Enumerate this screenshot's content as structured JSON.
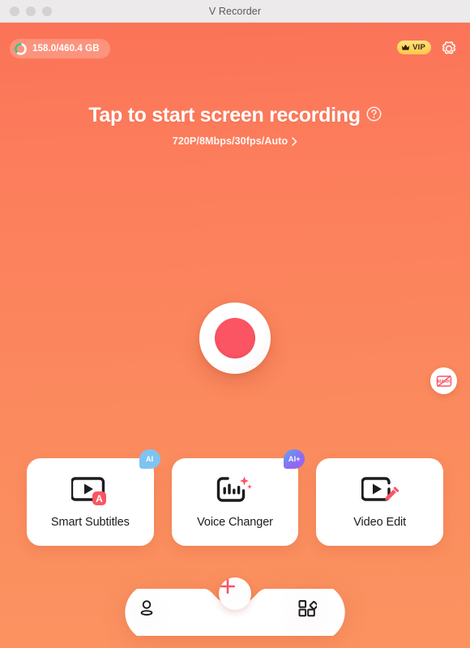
{
  "window": {
    "title": "V Recorder",
    "traffic_lights": [
      "close",
      "minimize",
      "zoom"
    ]
  },
  "topbar": {
    "storage_text": "158.0/460.4 GB",
    "storage_used_gb": 158.0,
    "storage_total_gb": 460.4,
    "vip_label": "VIP",
    "vip_icon": "crown-icon",
    "settings_icon": "gear-icon"
  },
  "hero": {
    "headline": "Tap to start screen recording",
    "help_icon": "question-circle-icon",
    "settings_summary": "720P/8Mbps/30fps/Auto",
    "chevron_icon": "chevron-right-icon"
  },
  "record": {
    "button_name": "record-button",
    "dot_color": "#fb5463"
  },
  "floating": {
    "no_watermark_icon": "no-watermark-icon"
  },
  "cards": [
    {
      "label": "Smart Subtitles",
      "icon": "subtitle-video-icon",
      "badge": "AI",
      "badge_style": "blue"
    },
    {
      "label": "Voice Changer",
      "icon": "voice-wave-icon",
      "badge": "AI+",
      "badge_style": "gradient"
    },
    {
      "label": "Video Edit",
      "icon": "video-edit-icon",
      "badge": "",
      "badge_style": ""
    }
  ],
  "bottomnav": {
    "profile_icon": "person-icon",
    "add_icon": "plus-icon",
    "apps_icon": "grid-apps-icon"
  },
  "colors": {
    "bg_top": "#fb7358",
    "bg_bottom": "#fb9360",
    "accent_red": "#fb5463",
    "vip_gold": "#ffc94d",
    "ai_blue": "#7ec4f2"
  }
}
